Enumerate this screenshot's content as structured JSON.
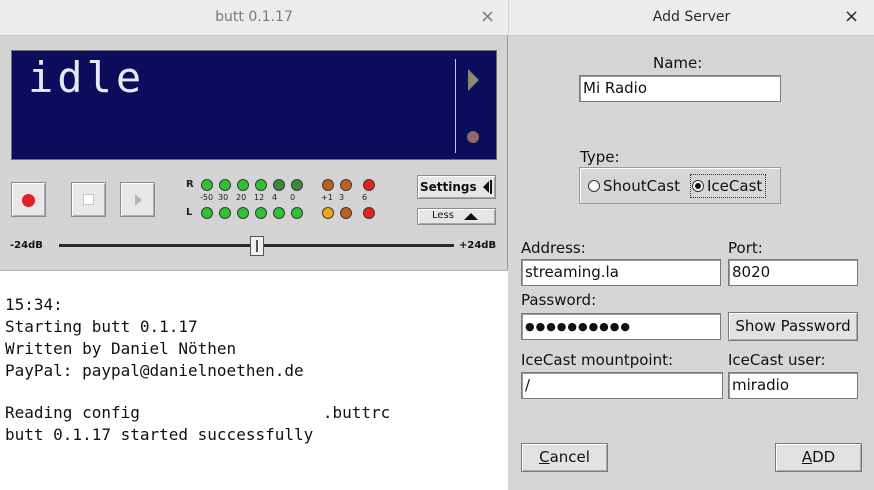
{
  "left_window": {
    "title": "butt 0.1.17",
    "close_glyph": "×",
    "display_text": "idle",
    "vu": {
      "channel_r": "R",
      "channel_l": "L",
      "scale": [
        "-50",
        "30",
        "20",
        "12",
        "4",
        "0",
        "+1",
        "3",
        "6"
      ],
      "led_colors_r": [
        "#2fc232",
        "#2fc232",
        "#2fc232",
        "#2fc232",
        "#3a8a3a",
        "#3a8a3a",
        "#c0601a",
        "#c0601a",
        "#e8201a"
      ],
      "led_colors_l": [
        "#2fc232",
        "#2fc232",
        "#2fc232",
        "#2fc232",
        "#2fc232",
        "#2fc232",
        "#f0a818",
        "#c0601a",
        "#e8201a"
      ]
    },
    "settings_label": "Settings",
    "less_label": "Less",
    "gain_min_label": "-24dB",
    "gain_max_label": "+24dB",
    "gain_level": 0.5,
    "log_lines": [
      "15:34:",
      "Starting butt 0.1.17",
      "Written by Daniel Nöthen",
      "PayPal: paypal@danielnoethen.de",
      "",
      "Reading config                   .buttrc",
      "butt 0.1.17 started successfully"
    ]
  },
  "dialog": {
    "title": "Add Server",
    "close_glyph": "×",
    "name_label": "Name:",
    "name_value": "Mi Radio",
    "type_label": "Type:",
    "type_options": [
      "ShoutCast",
      "IceCast"
    ],
    "type_selected": "IceCast",
    "address_label": "Address:",
    "address_value": "streaming.la",
    "port_label": "Port:",
    "port_value": "8020",
    "password_label": "Password:",
    "password_value": "●●●●●●●●●●",
    "show_password_label": "Show Password",
    "mountpoint_label": "IceCast mountpoint:",
    "mountpoint_value": "/",
    "user_label": "IceCast user:",
    "user_value": "miradio",
    "cancel_label": "Cancel",
    "add_label": "ADD"
  }
}
